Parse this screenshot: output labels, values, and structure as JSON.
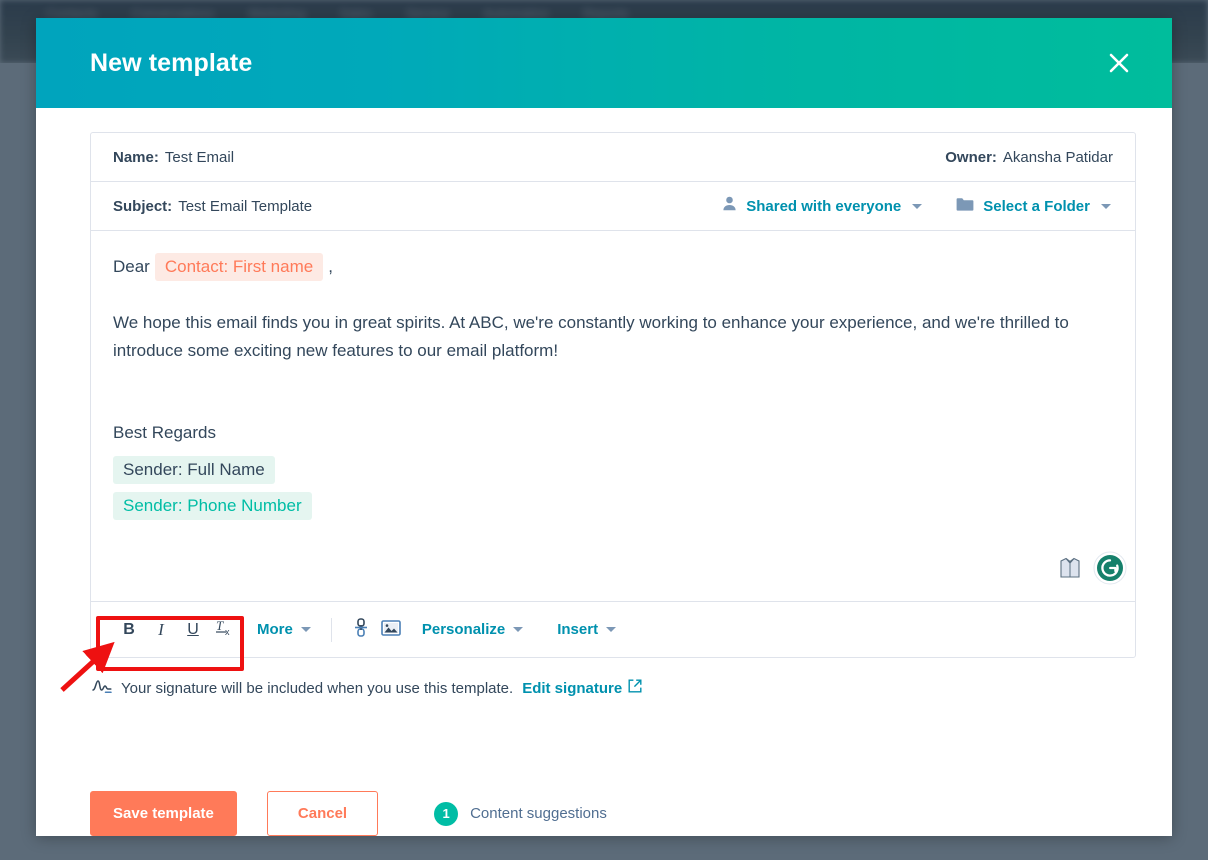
{
  "backdrop": {
    "nav_items": [
      "Contacts",
      "Conversations",
      "Marketing",
      "Sales",
      "Service",
      "Automation",
      "Reports"
    ]
  },
  "modal": {
    "title": "New template",
    "close_icon": "close-icon"
  },
  "fields": {
    "name_label": "Name:",
    "name_value": "Test Email",
    "owner_label": "Owner:",
    "owner_value": "Akansha Patidar",
    "subject_label": "Subject:",
    "subject_value": "Test Email Template",
    "sharing_label": "Shared with everyone",
    "folder_label": "Select a Folder"
  },
  "email": {
    "salutation_prefix": "Dear",
    "token_contact": "Contact: First name",
    "salutation_suffix": ",",
    "paragraph": "We hope this email finds you in great spirits. At ABC, we're constantly working to enhance your experience, and we're thrilled to introduce some exciting new features to our email platform!",
    "signoff": "Best Regards",
    "token_sender_name": "Sender: Full Name",
    "token_sender_phone": "Sender: Phone Number"
  },
  "toolbar": {
    "bold": "B",
    "italic": "I",
    "underline": "U",
    "clear_format": "Tx",
    "more_label": "More",
    "personalize_label": "Personalize",
    "insert_label": "Insert"
  },
  "signature_note": {
    "text": "Your signature will be included when you use this template.",
    "link_label": "Edit signature"
  },
  "footer": {
    "save_label": "Save template",
    "cancel_label": "Cancel",
    "suggestions_count": "1",
    "suggestions_label": "Content suggestions"
  },
  "colors": {
    "header_gradient_start": "#00a4bd",
    "header_gradient_end": "#00bd9c",
    "accent_link": "#0091ae",
    "primary_button": "#ff7a59",
    "token_contact_text": "#ff7a59",
    "token_contact_bg": "#fdeae4",
    "token_sender_bg": "#e5f5f0",
    "token_sender_text": "#00bda5",
    "annotation": "#ee1111",
    "badge": "#00bda5",
    "text": "#33475b"
  }
}
